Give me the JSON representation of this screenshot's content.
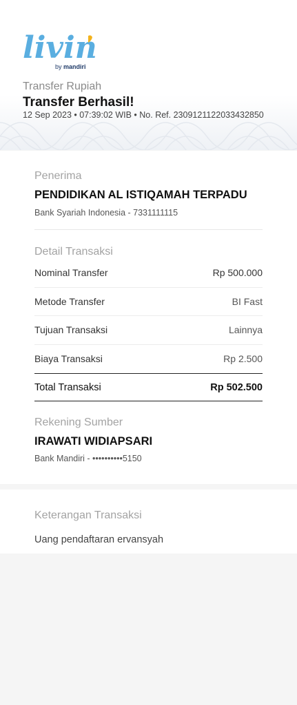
{
  "header": {
    "logo_text": "livin'",
    "logo_by": "by",
    "logo_brand": "mandiri",
    "transfer_type": "Transfer Rupiah",
    "status_title": "Transfer Berhasil!",
    "meta": "12 Sep 2023 • 07:39:02 WIB • No. Ref. 2309121122033432850"
  },
  "recipient": {
    "label": "Penerima",
    "name": "PENDIDIKAN AL ISTIQAMAH TERPADU",
    "bank": "Bank Syariah Indonesia - 7331111115"
  },
  "details": {
    "label": "Detail Transaksi",
    "rows": [
      {
        "label": "Nominal Transfer",
        "value": "Rp 500.000"
      },
      {
        "label": "Metode Transfer",
        "value": "BI Fast"
      },
      {
        "label": "Tujuan Transaksi",
        "value": "Lainnya"
      },
      {
        "label": "Biaya Transaksi",
        "value": "Rp 2.500"
      }
    ],
    "total_label": "Total Transaksi",
    "total_value": "Rp 502.500"
  },
  "source": {
    "label": "Rekening Sumber",
    "name": "IRAWATI WIDIAPSARI",
    "bank": "Bank Mandiri - ••••••••••5150"
  },
  "note": {
    "label": "Keterangan Transaksi",
    "text": "Uang pendaftaran ervansyah"
  },
  "colors": {
    "logo_blue": "#5aaee0",
    "logo_accent": "#f3b21b",
    "brand_navy": "#1f3a68"
  }
}
